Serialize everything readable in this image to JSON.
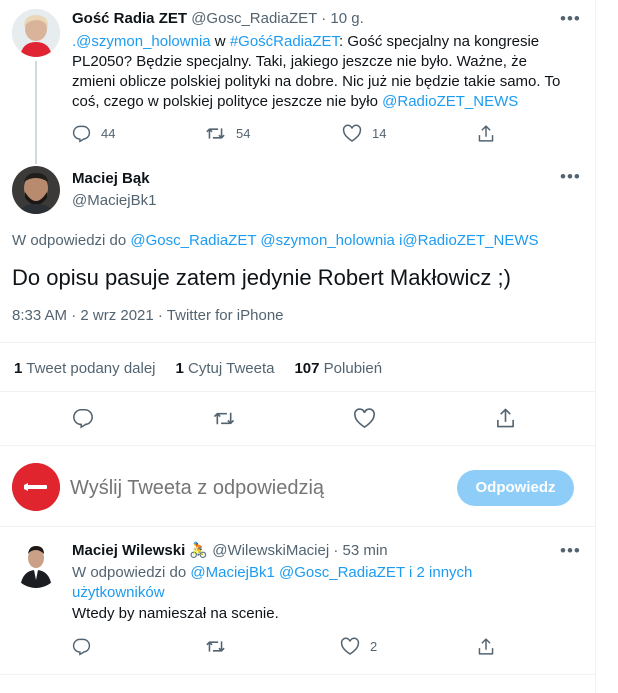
{
  "parent_tweet": {
    "name": "Gość Radia ZET",
    "handle": "@Gosc_RadiaZET",
    "time": "10 g.",
    "text_parts": [
      {
        "t": ".@szymon_holownia",
        "link": true
      },
      {
        "t": " w ",
        "link": false
      },
      {
        "t": "#GośćRadiaZET",
        "link": true
      },
      {
        "t": ": Gość specjalny na kongresie PL2050? Będzie specjalny. Taki, jakiego jeszcze nie było. Ważne, że zmieni oblicze polskiej polityki na dobre. Nic już nie będzie takie samo. To coś, czego w polskiej polityce jeszcze nie było ",
        "link": false
      },
      {
        "t": "@RadioZET_NEWS",
        "link": true
      }
    ],
    "replies": "44",
    "retweets": "54",
    "likes": "14"
  },
  "main_tweet": {
    "name": "Maciej Bąk",
    "handle": "@MaciejBk1",
    "reply_prefix": "W odpowiedzi do",
    "reply_to": [
      "@Gosc_RadiaZET",
      "@szymon_holownia",
      "i@RadioZET_NEWS"
    ],
    "text": "Do opisu pasuje zatem jedynie Robert Makłowicz ;)",
    "timestamp": "8:33 AM · 2 wrz 2021 · Twitter for iPhone",
    "stats": [
      {
        "count": "1",
        "label": "Tweet podany dalej"
      },
      {
        "count": "1",
        "label": "Cytuj Tweeta"
      },
      {
        "count": "107",
        "label": "Polubień"
      }
    ]
  },
  "composer": {
    "placeholder": "Wyślij Tweeta z odpowiedzią",
    "button": "Odpowiedz"
  },
  "reply_tweet": {
    "name": "Maciej Wilewski",
    "emoji": "🚴",
    "handle": "@WilewskiMaciej",
    "time": "53 min",
    "reply_prefix": "W odpowiedzi do",
    "reply_to": [
      "@MaciejBk1",
      "@Gosc_RadiaZET",
      "i 2 innych użytkowników"
    ],
    "text": "Wtedy by namieszał na scenie.",
    "likes": "2"
  },
  "colors": {
    "accent": "#1d9bf0",
    "muted": "#536471",
    "button_disabled": "#8ecdf8"
  },
  "icons": [
    "reply-icon",
    "retweet-icon",
    "like-icon",
    "share-icon",
    "more-icon"
  ]
}
